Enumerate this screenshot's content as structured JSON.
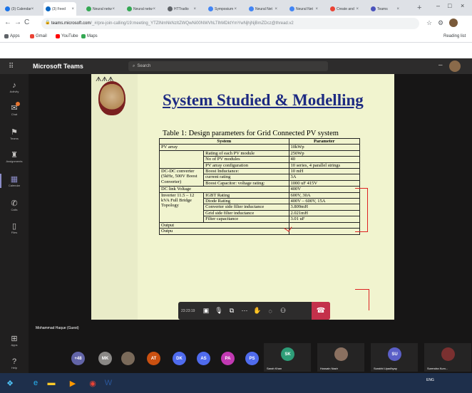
{
  "browser": {
    "tabs": [
      {
        "label": "(3) Calendar",
        "color": "#1a73e8"
      },
      {
        "label": "(3) Feed",
        "color": "#0a66c2",
        "active": true
      },
      {
        "label": "Neural netw",
        "color": "#34a853"
      },
      {
        "label": "Neural netw",
        "color": "#34a853"
      },
      {
        "label": "HTTradio",
        "color": "#5f6368"
      },
      {
        "label": "Symposium",
        "color": "#4285f4"
      },
      {
        "label": "Neural Net",
        "color": "#4285f4"
      },
      {
        "label": "Neural Net",
        "color": "#4285f4"
      },
      {
        "label": "Create and",
        "color": "#ea4335"
      },
      {
        "label": "Teams",
        "color": "#4b53bc"
      }
    ],
    "url_host": "teams.microsoft.com",
    "url_path": "/_#/pre-join-calling/19:meeting_YTZlNmNkNzItZWQwNi00NWVhLTlhMDktYmYwNjhjNjBmZDcz@thread.v2",
    "bookmarks": [
      {
        "label": "Apps",
        "color": "#5f6368"
      },
      {
        "label": "Gmail",
        "color": "#ea4335"
      },
      {
        "label": "YouTube",
        "color": "#ff0000"
      },
      {
        "label": "Maps",
        "color": "#34a853"
      }
    ],
    "reading_list": "Reading list"
  },
  "teams": {
    "app_title": "Microsoft Teams",
    "search_placeholder": "Search",
    "rail": [
      {
        "label": "Activity",
        "icon": "bell-icon"
      },
      {
        "label": "Chat",
        "icon": "chat-icon",
        "badge": true
      },
      {
        "label": "Teams",
        "icon": "teams-icon"
      },
      {
        "label": "Assignments",
        "icon": "assignments-icon"
      },
      {
        "label": "Calendar",
        "icon": "calendar-icon",
        "active": true
      },
      {
        "label": "Calls",
        "icon": "phone-icon"
      },
      {
        "label": "Files",
        "icon": "file-icon"
      },
      {
        "label": "Apps",
        "icon": "apps-icon"
      },
      {
        "label": "Help",
        "icon": "help-icon"
      }
    ],
    "presenter_name": "Mohammad Haque (Guest)",
    "call_timer": "23:23:19",
    "participants": [
      {
        "initials": "+48",
        "color": "#6264a7"
      },
      {
        "initials": "MK",
        "color": "#8a8886"
      },
      {
        "initials": "",
        "color": "#7a6a5a"
      },
      {
        "initials": "AT",
        "color": "#ca5010"
      },
      {
        "initials": "DK",
        "color": "#4f6bed"
      },
      {
        "initials": "AS",
        "color": "#4f6bed"
      },
      {
        "initials": "PA",
        "color": "#c239b3"
      },
      {
        "initials": "PS",
        "color": "#4f6bed"
      }
    ],
    "tiles": [
      {
        "initials": "SK",
        "name": "Sarah Khan",
        "color": "#2e9d78"
      },
      {
        "initials": "",
        "name": "Hussain Nazir",
        "color": "#8a7060"
      },
      {
        "initials": "SU",
        "name": "Surabhi Upadhyay",
        "color": "#5b5fc7"
      },
      {
        "initials": "",
        "name": "Surendra Kum...",
        "color": "#7a3030"
      }
    ]
  },
  "slide": {
    "logo_text": "ᗑᗑᗑ",
    "title": "System Studied & Modelling",
    "table_caption": "Table 1: Design parameters for Grid Connected PV system",
    "table": {
      "headers": [
        "System",
        "Parameter"
      ],
      "rows": [
        {
          "system": "PV array",
          "sub": "",
          "param": "10kWp"
        },
        {
          "system": "",
          "sub": "Rating of each PV module",
          "param": "250Wp"
        },
        {
          "system": "",
          "sub": "No of PV modules",
          "param": "40"
        },
        {
          "system": "",
          "sub": "PV array configuration",
          "param": "10 series, 4 parallel strings"
        },
        {
          "system": "DC-DC converter (5kHz, 500V Boost Converter)",
          "sub": "Boost Inductance:",
          "param": "10 mH"
        },
        {
          "system": "",
          "sub": "current rating",
          "param": "3A"
        },
        {
          "system": "",
          "sub": "Boost Capacitor: voltage rating:",
          "param": "1000 uF 415V"
        },
        {
          "system": "DC link Voltage",
          "sub": "",
          "param": "400V"
        },
        {
          "system": "Inverter 11.5 – 12 kVA Full Bridge Topology",
          "sub": "IGBT Rating",
          "param": "600V, 30A"
        },
        {
          "system": "",
          "sub": "Diode Rating",
          "param": "400V – 600V, 15A"
        },
        {
          "system": "",
          "sub": "Converter side filter inductance",
          "param": "3.809mH"
        },
        {
          "system": "",
          "sub": "Grid side filter inductance",
          "param": "2.021mH"
        },
        {
          "system": "",
          "sub": "Filter capacitance",
          "param": "3.01 uF"
        },
        {
          "system": "Output",
          "sub": "",
          "param": ""
        },
        {
          "system": "Outpu",
          "sub": "",
          "param": ""
        }
      ]
    }
  },
  "taskbar": {
    "apps": [
      {
        "icon": "windows-start-icon",
        "glyph": "❖",
        "color": "#4fc3f7"
      },
      {
        "icon": "ie-icon",
        "glyph": "e",
        "color": "#29b6f6"
      },
      {
        "icon": "folder-icon",
        "glyph": "▬",
        "color": "#ffca28"
      },
      {
        "icon": "media-icon",
        "glyph": "▶",
        "color": "#ff9800"
      },
      {
        "icon": "chrome-icon",
        "glyph": "◉",
        "color": "#ea4335"
      },
      {
        "icon": "word-icon",
        "glyph": "W",
        "color": "#2b579a"
      }
    ],
    "clock": "ENG"
  }
}
